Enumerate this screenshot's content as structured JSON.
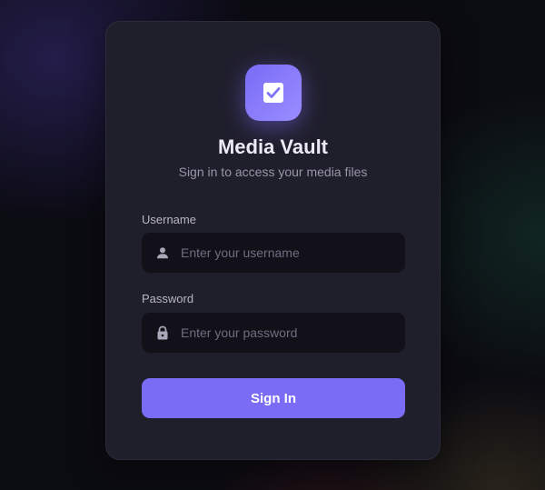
{
  "app": {
    "title": "Media Vault",
    "subtitle": "Sign in to access your media files",
    "logo_icon": "checkbox-icon"
  },
  "form": {
    "username": {
      "label": "Username",
      "placeholder": "Enter your username",
      "value": "",
      "icon": "user-icon"
    },
    "password": {
      "label": "Password",
      "placeholder": "Enter your password",
      "value": "",
      "icon": "lock-icon"
    },
    "submit_label": "Sign In"
  },
  "colors": {
    "accent": "#7b6cf6",
    "card": "#1f1e2b",
    "input": "#121119",
    "background": "#0b0b12"
  }
}
